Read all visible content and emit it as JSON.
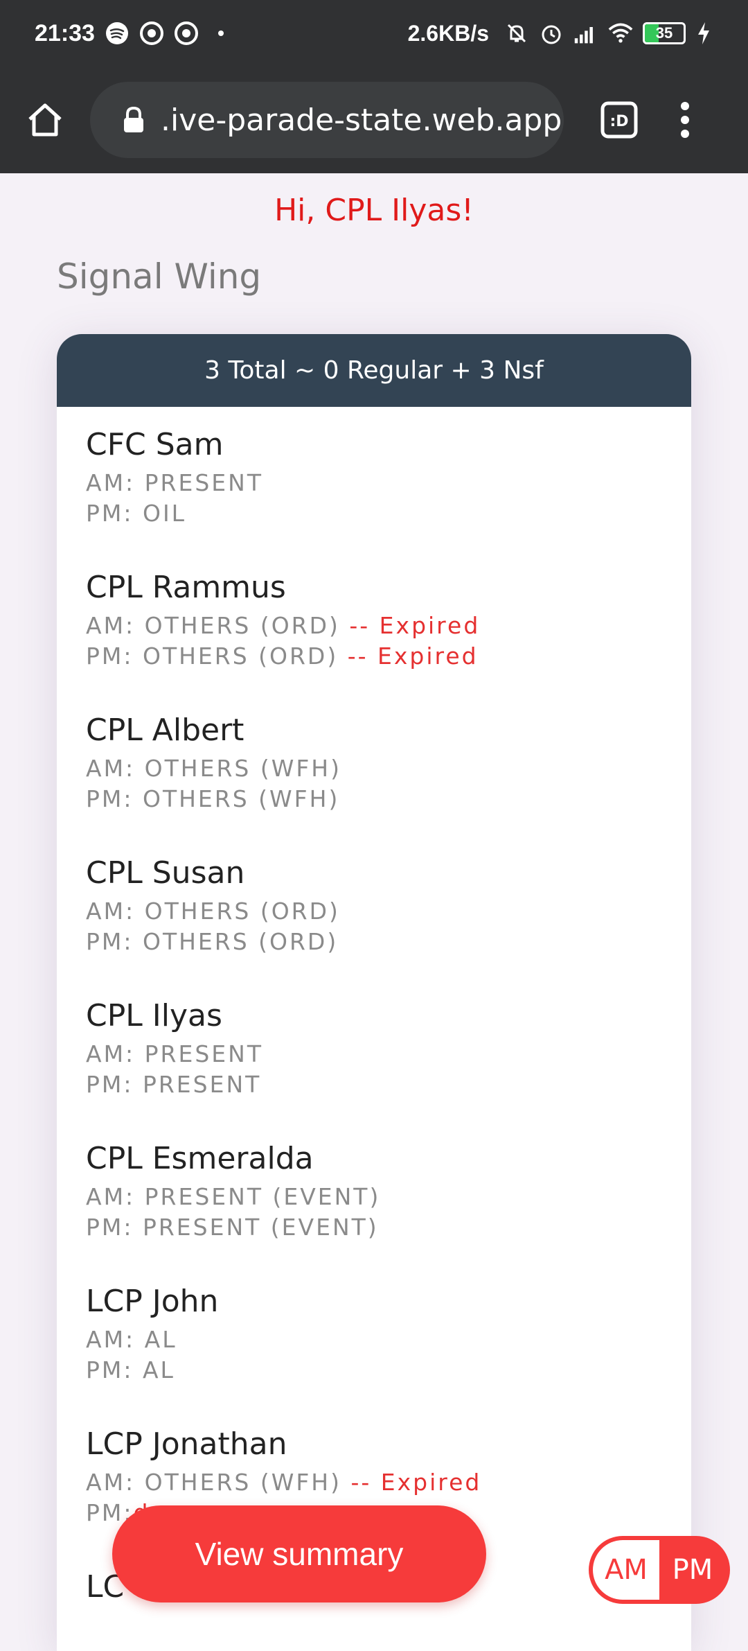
{
  "status_bar": {
    "time": "21:33",
    "network_speed": "2.6KB/s",
    "battery": "35",
    "icons": [
      "spotify-icon",
      "notification-icon",
      "notification-icon",
      "mute-icon",
      "alarm-icon",
      "signal-icon",
      "wifi-icon",
      "battery-icon",
      "charging-icon"
    ]
  },
  "browser": {
    "url": ".ive-parade-state.web.app",
    "tab_label": ":D"
  },
  "greeting": "Hi, CPL Ilyas!",
  "section_title": "Signal Wing",
  "summary_header": "3 Total ~ 0 Regular + 3 Nsf",
  "personnel": [
    {
      "name": "CFC Sam",
      "am": "AM: PRESENT",
      "am_flag": "",
      "pm": "PM: OIL",
      "pm_flag": ""
    },
    {
      "name": "CPL Rammus",
      "am": "AM: OTHERS (ORD)",
      "am_flag": " -- Expired",
      "pm": "PM: OTHERS (ORD)",
      "pm_flag": " -- Expired"
    },
    {
      "name": "CPL Albert",
      "am": "AM: OTHERS (WFH)",
      "am_flag": "",
      "pm": "PM: OTHERS (WFH)",
      "pm_flag": ""
    },
    {
      "name": "CPL Susan",
      "am": "AM: OTHERS (ORD)",
      "am_flag": "",
      "pm": "PM: OTHERS (ORD)",
      "pm_flag": ""
    },
    {
      "name": "CPL Ilyas",
      "am": "AM: PRESENT",
      "am_flag": "",
      "pm": "PM: PRESENT",
      "pm_flag": ""
    },
    {
      "name": "CPL Esmeralda",
      "am": "AM: PRESENT (EVENT)",
      "am_flag": "",
      "pm": "PM: PRESENT (EVENT)",
      "pm_flag": ""
    },
    {
      "name": "LCP John",
      "am": "AM: AL",
      "am_flag": "",
      "pm": "PM: AL",
      "pm_flag": ""
    },
    {
      "name": "LCP Jonathan",
      "am": "AM: OTHERS (WFH)",
      "am_flag": " -- Expired",
      "pm": "PM:",
      "pm_flag": "d"
    },
    {
      "name": "LC",
      "am": "",
      "am_flag": "",
      "pm": "",
      "pm_flag": ""
    }
  ],
  "actions": {
    "view_summary": "View summary",
    "am": "AM",
    "pm": "PM",
    "selected": "AM"
  },
  "colors": {
    "accent": "#f63b3b",
    "header": "#334454",
    "expired": "#e53030"
  }
}
